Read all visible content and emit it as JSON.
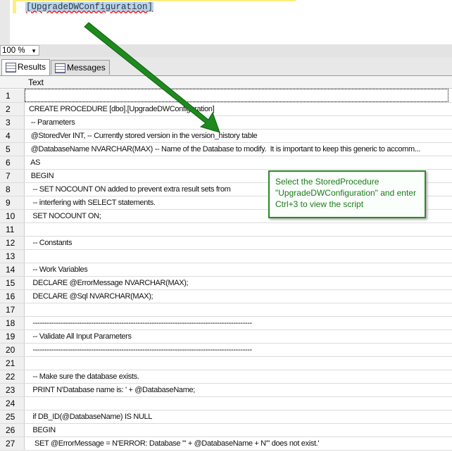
{
  "editor": {
    "code_text": "[UpgradeDWConfiguration]"
  },
  "zoom": {
    "value": "100 %"
  },
  "tabs": [
    {
      "label": "Results"
    },
    {
      "label": "Messages"
    }
  ],
  "grid": {
    "column_header": "Text",
    "rows": [
      {
        "n": "1",
        "t": ""
      },
      {
        "n": "2",
        "t": "CREATE PROCEDURE [dbo].[UpgradeDWConfiguration]"
      },
      {
        "n": "3",
        "t": " -- Parameters"
      },
      {
        "n": "4",
        "t": " @StoredVer INT, -- Currently stored version in the version_history table"
      },
      {
        "n": "5",
        "t": " @DatabaseName NVARCHAR(MAX) -- Name of the Database to modify.  It is important to keep this generic to accomm..."
      },
      {
        "n": "6",
        "t": " AS"
      },
      {
        "n": "7",
        "t": " BEGIN"
      },
      {
        "n": "8",
        "t": "  -- SET NOCOUNT ON added to prevent extra result sets from"
      },
      {
        "n": "9",
        "t": "  -- interfering with SELECT statements."
      },
      {
        "n": "10",
        "t": "  SET NOCOUNT ON;"
      },
      {
        "n": "11",
        "t": ""
      },
      {
        "n": "12",
        "t": "  -- Constants"
      },
      {
        "n": "13",
        "t": ""
      },
      {
        "n": "14",
        "t": "  -- Work Variables"
      },
      {
        "n": "15",
        "t": "  DECLARE @ErrorMessage NVARCHAR(MAX);"
      },
      {
        "n": "16",
        "t": "  DECLARE @Sql NVARCHAR(MAX);"
      },
      {
        "n": "17",
        "t": ""
      },
      {
        "n": "18",
        "t": "  ----------------------------------------------------------------------------------------------"
      },
      {
        "n": "19",
        "t": "  -- Validate All Input Parameters"
      },
      {
        "n": "20",
        "t": "  ----------------------------------------------------------------------------------------------"
      },
      {
        "n": "21",
        "t": ""
      },
      {
        "n": "22",
        "t": "  -- Make sure the database exists."
      },
      {
        "n": "23",
        "t": "  PRINT N'Database name is: ' + @DatabaseName;"
      },
      {
        "n": "24",
        "t": ""
      },
      {
        "n": "25",
        "t": "  if DB_ID(@DatabaseName) IS NULL"
      },
      {
        "n": "26",
        "t": "  BEGIN"
      },
      {
        "n": "27",
        "t": "   SET @ErrorMessage = N'ERROR: Database ''' + @DatabaseName + N''' does not exist.'"
      }
    ]
  },
  "callout": {
    "text": "Select the StoredProcedure \"UpgradeDWConfiguration\" and enter Ctrl+3 to view the script"
  },
  "colors": {
    "arrow": "#1e8a1e",
    "callout_border": "#2a8a2a"
  }
}
